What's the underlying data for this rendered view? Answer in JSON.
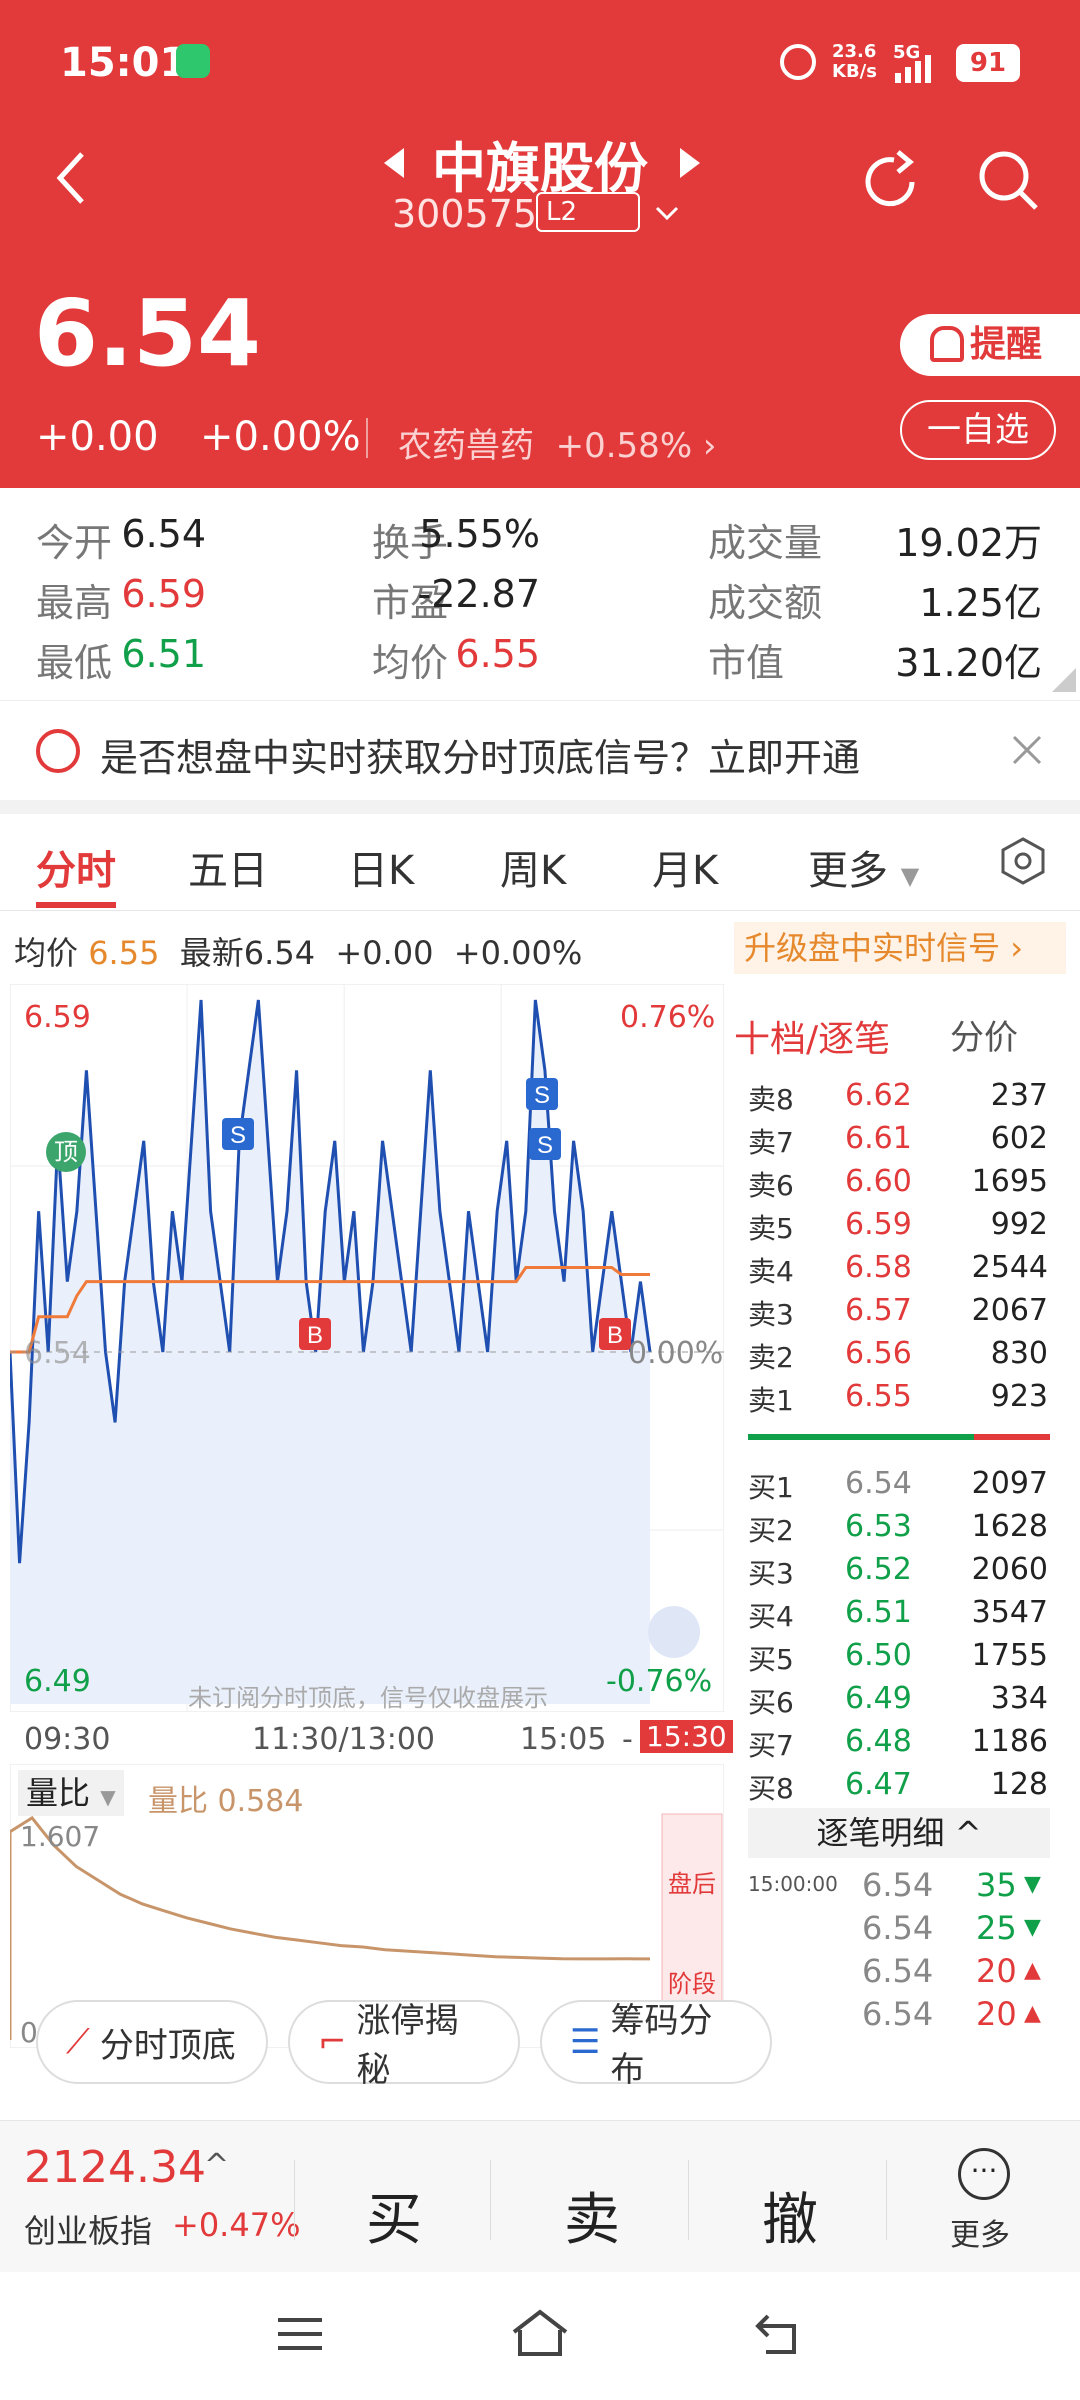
{
  "status_bar": {
    "time": "15:01",
    "net_speed_top": "23.6",
    "net_speed_unit": "KB/s",
    "signal": "5G",
    "battery": "91"
  },
  "header": {
    "stock_name": "中旗股份",
    "stock_code": "300575",
    "level": "L2",
    "price": "6.54",
    "change": "+0.00",
    "change_pct": "+0.00%",
    "sector": "农药兽药",
    "sector_pct": "+0.58%",
    "remind_label": "提醒",
    "watchlist_label": "一自选"
  },
  "stats": [
    {
      "label": "今开",
      "value": "6.54",
      "color": "#222"
    },
    {
      "label": "换手",
      "value": "5.55%",
      "color": "#222"
    },
    {
      "label": "成交量",
      "value": "19.02万",
      "color": "#222"
    },
    {
      "label": "最高",
      "value": "6.59",
      "color": "#e2393a"
    },
    {
      "label": "市盈",
      "value": "-22.87",
      "color": "#222"
    },
    {
      "label": "成交额",
      "value": "1.25亿",
      "color": "#222"
    },
    {
      "label": "最低",
      "value": "6.51",
      "color": "#11a04a"
    },
    {
      "label": "均价",
      "value": "6.55",
      "color": "#e2393a"
    },
    {
      "label": "市值",
      "value": "31.20亿",
      "color": "#222"
    }
  ],
  "banner": {
    "text": "是否想盘中实时获取分时顶底信号？立即开通"
  },
  "tabs": [
    "分时",
    "五日",
    "日K",
    "周K",
    "月K",
    "更多"
  ],
  "info_line": {
    "avg_label": "均价",
    "avg_value": "6.55",
    "latest_label": "最新",
    "latest_value": "6.54",
    "change": "+0.00",
    "change_pct": "+0.00%",
    "upgrade_label": "升级盘中实时信号"
  },
  "chart": {
    "y_max": "6.59",
    "y_min": "6.49",
    "pct_max": "0.76%",
    "pct_min": "-0.76%",
    "mid_label": "0.00%",
    "mid_price": "6.54",
    "watermark": "未订阅分时顶底，信号仅收盘展示",
    "time_start": "09:30",
    "time_mid": "11:30/13:00",
    "time_now": "15:05",
    "time_end": "15:30",
    "top_signal": "顶"
  },
  "chart_data": {
    "type": "line",
    "title": "",
    "series": [
      {
        "name": "",
        "color": "#1f4fb0",
        "values": [
          6.54,
          6.51,
          6.53,
          6.56,
          6.54,
          6.57,
          6.55,
          6.56,
          6.58,
          6.56,
          6.54,
          6.53,
          6.55,
          6.56,
          6.57,
          6.55,
          6.54,
          6.56,
          6.55,
          6.57,
          6.59,
          6.56,
          6.55,
          6.54,
          6.57,
          6.58,
          6.59,
          6.57,
          6.55,
          6.56,
          6.58,
          6.55,
          6.54,
          6.56,
          6.57,
          6.55,
          6.56,
          6.54,
          6.55,
          6.57,
          6.56,
          6.55,
          6.54,
          6.56,
          6.58,
          6.56,
          6.55,
          6.54,
          6.56,
          6.55,
          6.54,
          6.56,
          6.57,
          6.55,
          6.56,
          6.59,
          6.58,
          6.56,
          6.55,
          6.57,
          6.56,
          6.54,
          6.55,
          6.56,
          6.55,
          6.54,
          6.55,
          6.54
        ]
      },
      {
        "name": "",
        "color": "#ef7a3a",
        "values": [
          6.54,
          6.54,
          6.54,
          6.545,
          6.545,
          6.545,
          6.545,
          6.548,
          6.55,
          6.55,
          6.55,
          6.55,
          6.55,
          6.55,
          6.55,
          6.55,
          6.55,
          6.55,
          6.55,
          6.55,
          6.55,
          6.55,
          6.55,
          6.55,
          6.55,
          6.55,
          6.55,
          6.55,
          6.55,
          6.55,
          6.55,
          6.55,
          6.55,
          6.55,
          6.55,
          6.55,
          6.55,
          6.55,
          6.55,
          6.55,
          6.55,
          6.55,
          6.55,
          6.55,
          6.55,
          6.55,
          6.55,
          6.55,
          6.55,
          6.55,
          6.55,
          6.55,
          6.55,
          6.55,
          6.552,
          6.552,
          6.552,
          6.552,
          6.552,
          6.552,
          6.552,
          6.552,
          6.552,
          6.552,
          6.551,
          6.551,
          6.551,
          6.551
        ]
      }
    ],
    "ylim": [
      6.49,
      6.59
    ]
  },
  "signals": [
    {
      "type": "S",
      "label": "S"
    },
    {
      "type": "B",
      "label": "B"
    },
    {
      "type": "S",
      "label": "S"
    },
    {
      "type": "S",
      "label": "S"
    },
    {
      "type": "B",
      "label": "B"
    }
  ],
  "volume": {
    "label": "量比",
    "value_label": "量比 0.584",
    "max": "1.607",
    "min": "0.000",
    "after_hours": "盘后",
    "stage": "阶段",
    "series": [
      1.5,
      1.6,
      1.4,
      1.25,
      1.15,
      1.05,
      0.98,
      0.93,
      0.88,
      0.84,
      0.8,
      0.77,
      0.74,
      0.72,
      0.7,
      0.68,
      0.67,
      0.65,
      0.64,
      0.63,
      0.62,
      0.61,
      0.6,
      0.595,
      0.59,
      0.585,
      0.584,
      0.584,
      0.585,
      0.584
    ]
  },
  "orderbook": {
    "title": "十档/逐笔",
    "subtitle": "分价",
    "asks": [
      {
        "label": "卖8",
        "price": "6.62",
        "vol": "237"
      },
      {
        "label": "卖7",
        "price": "6.61",
        "vol": "602"
      },
      {
        "label": "卖6",
        "price": "6.60",
        "vol": "1695"
      },
      {
        "label": "卖5",
        "price": "6.59",
        "vol": "992"
      },
      {
        "label": "卖4",
        "price": "6.58",
        "vol": "2544"
      },
      {
        "label": "卖3",
        "price": "6.57",
        "vol": "2067"
      },
      {
        "label": "卖2",
        "price": "6.56",
        "vol": "830"
      },
      {
        "label": "卖1",
        "price": "6.55",
        "vol": "923"
      }
    ],
    "bids": [
      {
        "label": "买1",
        "price": "6.54",
        "vol": "2097"
      },
      {
        "label": "买2",
        "price": "6.53",
        "vol": "1628"
      },
      {
        "label": "买3",
        "price": "6.52",
        "vol": "2060"
      },
      {
        "label": "买4",
        "price": "6.51",
        "vol": "3547"
      },
      {
        "label": "买5",
        "price": "6.50",
        "vol": "1755"
      },
      {
        "label": "买6",
        "price": "6.49",
        "vol": "334"
      },
      {
        "label": "买7",
        "price": "6.48",
        "vol": "1186"
      },
      {
        "label": "买8",
        "price": "6.47",
        "vol": "128"
      }
    ],
    "ticks_title": "逐笔明细",
    "ticks": [
      {
        "time": "15:00:00",
        "price": "6.54",
        "vol": "35",
        "dir": "down"
      },
      {
        "time": "",
        "price": "6.54",
        "vol": "25",
        "dir": "down"
      },
      {
        "time": "",
        "price": "6.54",
        "vol": "20",
        "dir": "up"
      },
      {
        "time": "",
        "price": "6.54",
        "vol": "20",
        "dir": "up"
      }
    ]
  },
  "tools": [
    "分时顶底",
    "涨停揭秘",
    "筹码分布"
  ],
  "bottom": {
    "index_value": "2124.34",
    "index_name": "创业板指",
    "index_pct": "+0.47%",
    "buy": "买",
    "sell": "卖",
    "cancel": "撤",
    "more": "更多"
  }
}
